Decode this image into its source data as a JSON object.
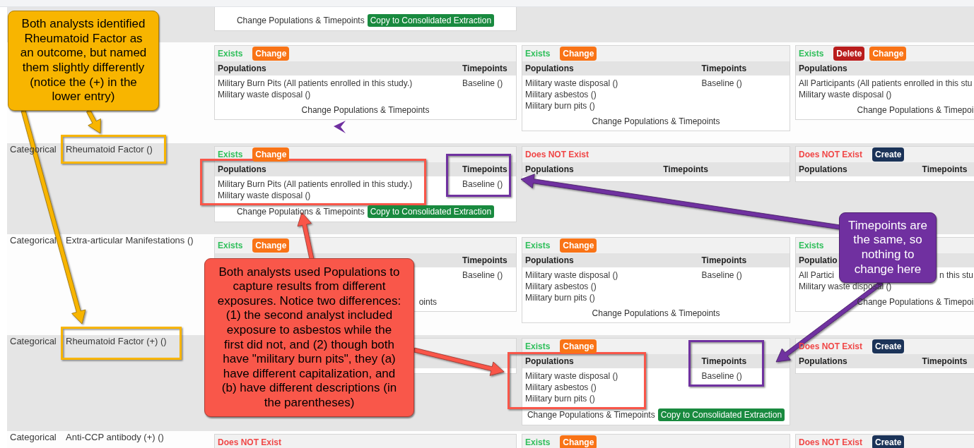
{
  "rows": [
    {
      "cards": [
        {
          "kind": "record",
          "footer": "Change Populations & Timepoints",
          "copy_button": "Copy to Consolidated Extraction"
        }
      ]
    },
    {
      "cards": [
        {
          "kind": "record",
          "status": {
            "label": "Exists",
            "exists": true
          },
          "buttons": [
            {
              "kind": "change",
              "label": "Change"
            }
          ],
          "populations_heading": "Populations",
          "timepoints_heading": "Timepoints",
          "populations": [
            "Military Burn Pits (All patients enrolled in this study.)",
            "Military waste disposal ()"
          ],
          "timepoints": [
            "Baseline ()"
          ],
          "footer": "Change Populations & Timepoints"
        },
        {
          "kind": "record",
          "status": {
            "label": "Exists",
            "exists": true
          },
          "buttons": [
            {
              "kind": "change",
              "label": "Change"
            }
          ],
          "populations_heading": "Populations",
          "timepoints_heading": "Timepoints",
          "populations": [
            "Military waste disposal ()",
            "Military asbestos ()",
            "Military burn pits ()"
          ],
          "timepoints": [
            "Baseline ()"
          ],
          "footer": "Change Populations & Timepoints"
        },
        {
          "kind": "record",
          "status": {
            "label": "Exists",
            "exists": true
          },
          "buttons": [
            {
              "kind": "delete",
              "label": "Delete"
            },
            {
              "kind": "change",
              "label": "Change"
            }
          ],
          "populations_heading": "Populations",
          "populations": [
            "All Participants (All patients enrolled in this stu",
            "Military waste disposal ()"
          ],
          "footer": "Change Populations & Timepoi"
        }
      ]
    },
    {
      "type": "Categorical",
      "name": "Rheumatoid Factor ()",
      "cards": [
        {
          "kind": "record",
          "status": {
            "label": "Exists",
            "exists": true
          },
          "buttons": [
            {
              "kind": "change",
              "label": "Change"
            }
          ],
          "populations_heading": "Populations",
          "timepoints_heading": "Timepoints",
          "populations": [
            "Military Burn Pits (All patients enrolled in this study.)",
            "Military waste disposal ()"
          ],
          "timepoints": [
            "Baseline ()"
          ],
          "footer": "Change Populations & Timepoints",
          "copy_button": "Copy to Consolidated Extraction"
        },
        {
          "kind": "record",
          "status": {
            "label": "Does NOT Exist",
            "exists": false
          },
          "populations_heading": "Populations",
          "timepoints_heading": "Timepoints"
        },
        {
          "kind": "record",
          "status": {
            "label": "Does NOT Exist",
            "exists": false
          },
          "buttons": [
            {
              "kind": "create",
              "label": "Create"
            }
          ],
          "populations_heading": "Populations",
          "timepoints_heading": "Timepoints"
        }
      ]
    },
    {
      "type": "Categorical",
      "name": "Extra-articular Manifestations ()",
      "cards": [
        {
          "kind": "obscured",
          "status": {
            "label": "Exists",
            "exists": true
          },
          "buttons": [
            {
              "kind": "change",
              "label": "Change"
            }
          ],
          "timepoints_heading": "Timepoints",
          "timepoints": [
            "Baseline ()"
          ],
          "footer": "oints"
        },
        {
          "kind": "record",
          "status": {
            "label": "Exists",
            "exists": true
          },
          "buttons": [
            {
              "kind": "change",
              "label": "Change"
            }
          ],
          "populations_heading": "Populations",
          "timepoints_heading": "Timepoints",
          "populations": [
            "Military waste disposal ()",
            "Military asbestos ()",
            "Military burn pits ()"
          ],
          "timepoints": [
            "Baseline ()"
          ],
          "footer": "Change Populations & Timepoints"
        },
        {
          "kind": "record",
          "status": {
            "label": "Exists",
            "exists": true
          },
          "populations_heading": "Populatio",
          "populations": [
            [
              "All Partici",
              "n this stu"
            ],
            "Military waste disposal ()"
          ],
          "footer": "Change Populations & Timepoi"
        }
      ]
    },
    {
      "type": "Categorical",
      "name": "Rheumatoid Factor (+) ()",
      "cards": [
        {
          "kind": "obscured"
        },
        {
          "kind": "record",
          "status": {
            "label": "Exists",
            "exists": true
          },
          "buttons": [
            {
              "kind": "change",
              "label": "Change"
            }
          ],
          "populations_heading": "Populations",
          "timepoints_heading": "Timepoints",
          "populations": [
            "Military waste disposal ()",
            "Military asbestos ()",
            "Military burn pits ()"
          ],
          "timepoints": [
            "Baseline ()"
          ],
          "footer": "Change Populations & Timepoints",
          "copy_button": "Copy to Consolidated Extraction"
        },
        {
          "kind": "record",
          "status": {
            "label": "Does NOT Exist",
            "exists": false
          },
          "buttons": [
            {
              "kind": "create",
              "label": "Create"
            }
          ],
          "populations_heading": "Populations",
          "timepoints_heading": "Timepoints"
        }
      ]
    },
    {
      "type": "Categorical",
      "name": "Anti-CCP antibody (+) ()",
      "cards": [
        {
          "kind": "record",
          "status": {
            "label": "Does NOT Exist",
            "exists": false
          }
        },
        {
          "kind": "record",
          "status": {
            "label": "Exists",
            "exists": true
          },
          "buttons": [
            {
              "kind": "change",
              "label": "Change"
            }
          ]
        },
        {
          "kind": "record",
          "status": {
            "label": "Does NOT Exist",
            "exists": false
          },
          "buttons": [
            {
              "kind": "create",
              "label": "Create"
            }
          ]
        }
      ]
    }
  ],
  "notes": [
    {
      "color": "#f8b500",
      "text": "Both analysts identified Rheumatoid Factor as an outcome, but named them slightly differently (notice the (+) in the lower entry)"
    },
    {
      "color": "#f9574a",
      "text": "Both analysts used Populations to capture results from different exposures. Notice two differences: (1) the second analyst included exposure to asbestos while the first did not, and (2) though both have \"military burn pits\", they (a) have different capitalization, and (b) have different descriptions (in the parentheses)"
    },
    {
      "color": "#7030a0",
      "text": "Timepoints are the same, so nothing to change here"
    }
  ]
}
